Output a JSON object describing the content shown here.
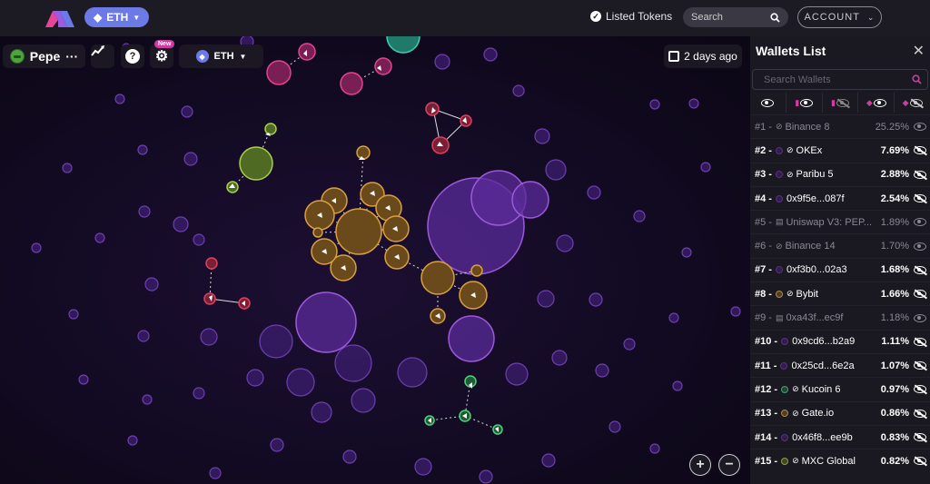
{
  "header": {
    "chain_label": "ETH",
    "listed_tokens_label": "Listed Tokens",
    "search_placeholder": "Search",
    "account_label": "ACCOUNT"
  },
  "graph_controls": {
    "token_name": "Pepe",
    "token_more": "···",
    "help_label": "?",
    "new_badge": "New",
    "chain_selector": "ETH",
    "date_label": "2 days ago",
    "zoom_in": "+",
    "zoom_out": "−"
  },
  "wallets_panel": {
    "title": "Wallets List",
    "close": "✕",
    "search_placeholder": "Search Wallets",
    "rows": [
      {
        "rank": "#1 -",
        "name": "Binance 8",
        "pct": "25.25%",
        "dim": true,
        "dot": "",
        "type": "contract"
      },
      {
        "rank": "#2 -",
        "name": "OKEx",
        "pct": "7.69%",
        "dim": false,
        "dot": "#5a2e8a",
        "type": "contract"
      },
      {
        "rank": "#3 -",
        "name": "Paribu 5",
        "pct": "2.88%",
        "dim": false,
        "dot": "#5a2e8a",
        "type": "contract"
      },
      {
        "rank": "#4 -",
        "name": "0x9f5e...087f",
        "pct": "2.54%",
        "dim": false,
        "dot": "#5a2e8a",
        "type": ""
      },
      {
        "rank": "#5 -",
        "name": "Uniswap V3: PEP...",
        "pct": "1.89%",
        "dim": true,
        "dot": "",
        "type": "doc"
      },
      {
        "rank": "#6 -",
        "name": "Binance 14",
        "pct": "1.70%",
        "dim": true,
        "dot": "",
        "type": "contract"
      },
      {
        "rank": "#7 -",
        "name": "0xf3b0...02a3",
        "pct": "1.68%",
        "dim": false,
        "dot": "#5a2e8a",
        "type": ""
      },
      {
        "rank": "#8 -",
        "name": "Bybit",
        "pct": "1.66%",
        "dim": false,
        "dot": "#b08a3a",
        "type": "contract"
      },
      {
        "rank": "#9 -",
        "name": "0xa43f...ec9f",
        "pct": "1.18%",
        "dim": true,
        "dot": "",
        "type": "doc"
      },
      {
        "rank": "#10 -",
        "name": "0x9cd6...b2a9",
        "pct": "1.11%",
        "dim": false,
        "dot": "#5a2e8a",
        "type": ""
      },
      {
        "rank": "#11 -",
        "name": "0x25cd...6e2a",
        "pct": "1.07%",
        "dim": false,
        "dot": "#5a2e8a",
        "type": ""
      },
      {
        "rank": "#12 -",
        "name": "Kucoin 6",
        "pct": "0.97%",
        "dim": false,
        "dot": "#3aa36a",
        "type": "contract"
      },
      {
        "rank": "#13 -",
        "name": "Gate.io",
        "pct": "0.86%",
        "dim": false,
        "dot": "#b08a3a",
        "type": "contract"
      },
      {
        "rank": "#14 -",
        "name": "0x46f8...ee9b",
        "pct": "0.83%",
        "dim": false,
        "dot": "#5a2e8a",
        "type": ""
      },
      {
        "rank": "#15 -",
        "name": "MXC Global",
        "pct": "0.82%",
        "dim": false,
        "dot": "#8aa33a",
        "type": "contract"
      }
    ]
  },
  "colors": {
    "accent": "#6c7ae8",
    "pink": "#d13aa0",
    "panel_bg": "#1a1820"
  }
}
